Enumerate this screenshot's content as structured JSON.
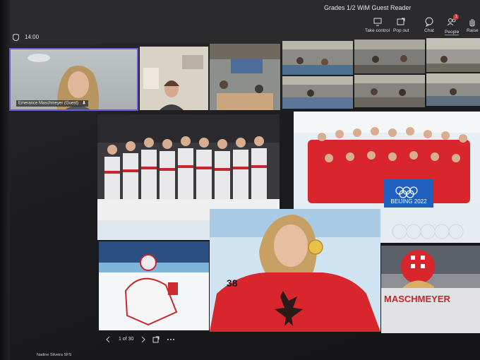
{
  "window": {
    "title": "Grades 1/2 WiM Guest Reader"
  },
  "call": {
    "elapsed_time": "14:00"
  },
  "toolbar": {
    "take_control": "Take control",
    "pop_out": "Pop out",
    "chat": "Chat",
    "people": "People",
    "people_badge": "1",
    "raise": "Raise"
  },
  "self_view": {
    "name": "Emerance Maschmeyer (Guest)"
  },
  "shared_content": {
    "banner_text": "BEIJING 2022",
    "jersey_text": "MASCHMEYER",
    "jersey_number": "38"
  },
  "pager": {
    "label": "1 of 30"
  },
  "presenter": {
    "name": "Nadine Silveira SFS"
  },
  "colors": {
    "accent": "#6b5bd6",
    "team_red": "#d8262c",
    "ice_blue": "#9ec8e6"
  }
}
